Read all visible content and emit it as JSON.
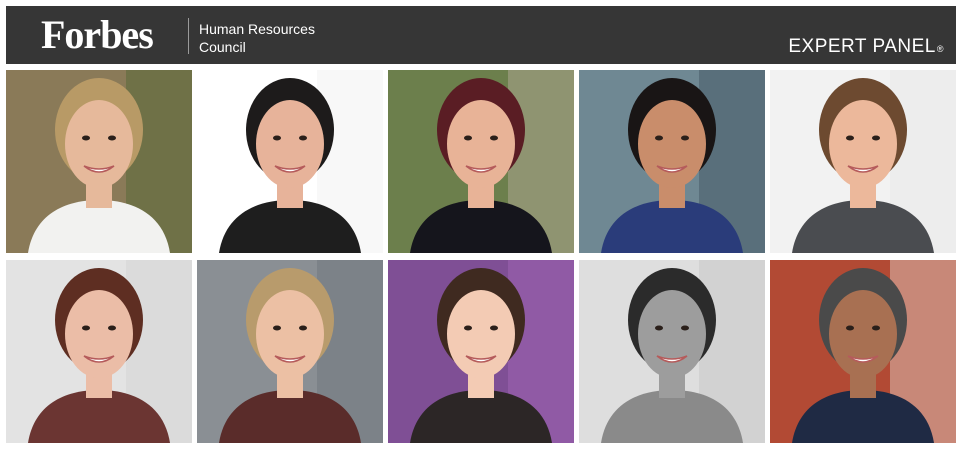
{
  "header": {
    "brand": "Forbes",
    "council_line1": "Human Resources",
    "council_line2": "Council",
    "panel_label": "EXPERT PANEL",
    "panel_mark": "®",
    "background": "#363636"
  },
  "panel": {
    "members": [
      {
        "bg": "#8a7a58",
        "bg2": "#5e6b3c",
        "hair": "#b89a66",
        "skin": "#e6b99b",
        "shirt": "#f2f2f0"
      },
      {
        "bg": "#ffffff",
        "bg2": "#f4f4f4",
        "hair": "#1d1b1b",
        "skin": "#e7b39a",
        "shirt": "#1e1e1e"
      },
      {
        "bg": "#6c7f4c",
        "bg2": "#a7a28b",
        "hair": "#5a1d24",
        "skin": "#e8b397",
        "shirt": "#15151c"
      },
      {
        "bg": "#6f8893",
        "bg2": "#4b5f6b",
        "hair": "#191515",
        "skin": "#c98d6b",
        "shirt": "#2a3c7a"
      },
      {
        "bg": "#f2f2f2",
        "bg2": "#e9e9e9",
        "hair": "#6d4a30",
        "skin": "#ecb89b",
        "shirt": "#4a4c50"
      },
      {
        "bg": "#e3e3e3",
        "bg2": "#d6d6d6",
        "hair": "#5e2e22",
        "skin": "#ebbda7",
        "shirt": "#6b3532"
      },
      {
        "bg": "#8a8f94",
        "bg2": "#737a80",
        "hair": "#b89b6c",
        "skin": "#ecc0a4",
        "shirt": "#5a2c2a"
      },
      {
        "bg": "#7f4f95",
        "bg2": "#9b63b0",
        "hair": "#3f2a20",
        "skin": "#f3cbb4",
        "shirt": "#2c2626"
      },
      {
        "bg": "#dedede",
        "bg2": "#c9c9c9",
        "hair": "#2b2b2b",
        "skin": "#9d9d9d",
        "shirt": "#8a8a8a"
      },
      {
        "bg": "#b24a34",
        "bg2": "#d7b3a6",
        "hair": "#4a4a4a",
        "skin": "#a87052",
        "shirt": "#1f2a44"
      }
    ]
  }
}
